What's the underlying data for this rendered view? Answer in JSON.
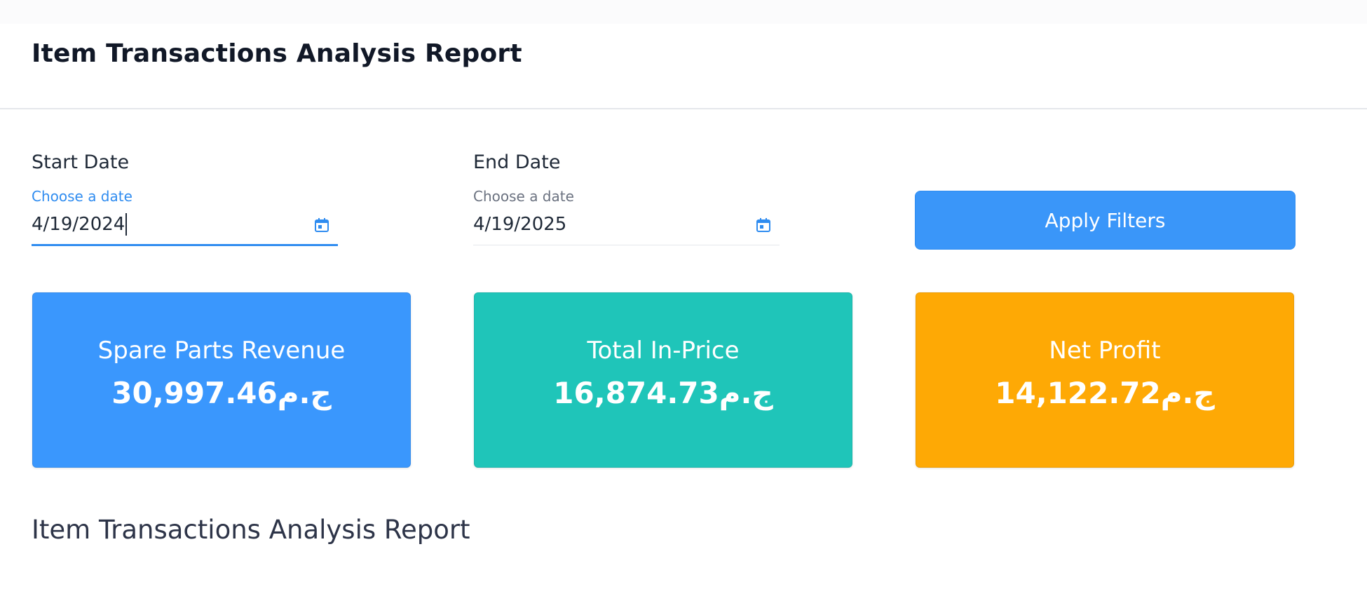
{
  "header": {
    "title": "Item Transactions Analysis Report"
  },
  "filters": {
    "start": {
      "label": "Start Date",
      "placeholder": "Choose a date",
      "value": "4/19/2024"
    },
    "end": {
      "label": "End Date",
      "placeholder": "Choose a date",
      "value": "4/19/2025"
    },
    "apply_label": "Apply Filters",
    "icon": "calendar-icon"
  },
  "cards": [
    {
      "title": "Spare Parts Revenue",
      "value": "30,997.46ج.م",
      "color": "#3a97fd"
    },
    {
      "title": "Total In-Price",
      "value": "16,874.73ج.م",
      "color": "#1fc5b9"
    },
    {
      "title": "Net Profit",
      "value": "14,122.72ج.م",
      "color": "#fea905"
    }
  ],
  "section": {
    "title": "Item Transactions Analysis Report"
  },
  "colors": {
    "accent": "#2f8cf0",
    "button": "#3a96f9"
  }
}
